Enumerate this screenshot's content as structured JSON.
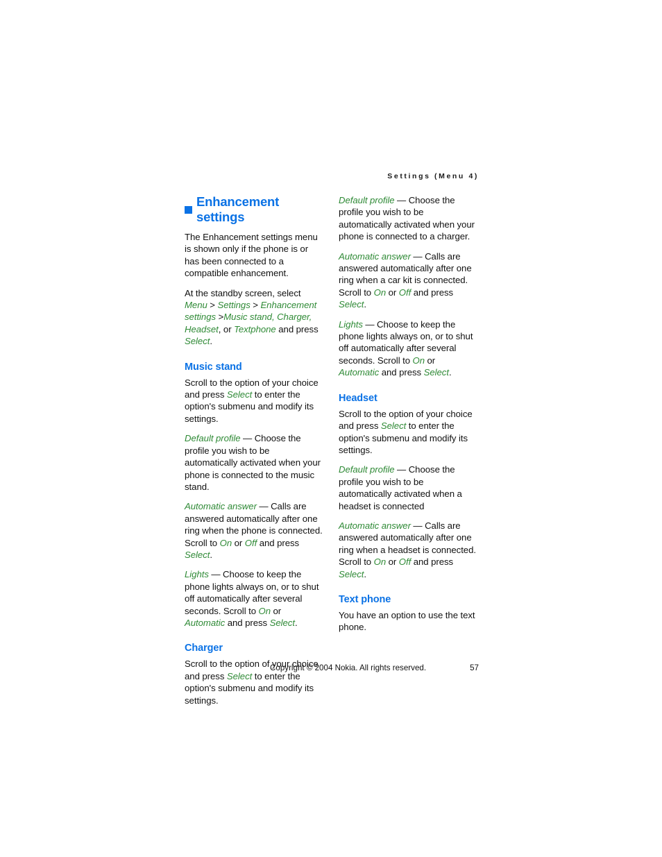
{
  "header": {
    "running_head": "Settings (Menu 4)"
  },
  "chapter": {
    "title": "Enhancement settings"
  },
  "left_column": {
    "intro_paragraph": "The Enhancement settings menu is shown only if the phone is or has been connected to a compatible enhancement.",
    "path_paragraph": {
      "part1": "At the standby screen, select ",
      "menu": "Menu",
      "part2": " > ",
      "settings": "Settings",
      "part3": " > ",
      "enhancement_settings": "Enhancement settings",
      "part4": " >",
      "music_stand": "Music stand, Charger, Headset",
      "part5": ", or ",
      "textphone": "Textphone",
      "part6": " and press ",
      "select": "Select",
      "part7": "."
    },
    "music_stand": {
      "heading": "Music stand",
      "scroll_text": {
        "part1": "Scroll to the option of your choice and press ",
        "select": "Select",
        "part2": " to enter the option's submenu and modify its settings."
      },
      "default_profile": {
        "term": "Default profile",
        "text": " — Choose the profile you wish to be automatically activated when your phone is connected to the music stand."
      },
      "automatic_answer": {
        "term": "Automatic answer",
        "part1": " — Calls are answered automatically after one ring when the phone is connected. Scroll to ",
        "on": "On",
        "part2": " or ",
        "off": "Off",
        "part3": " and press ",
        "select": "Select",
        "part4": "."
      },
      "lights": {
        "term": "Lights",
        "part1": " — Choose to keep the phone lights always on, or to shut off automatically after several seconds. Scroll to ",
        "on": "On",
        "part2": " or ",
        "automatic": "Automatic",
        "part3": " and press ",
        "select": "Select",
        "part4": "."
      }
    },
    "charger": {
      "heading": "Charger",
      "scroll_text": {
        "part1": "Scroll to the option of your choice and press ",
        "select": "Select",
        "part2": " to enter the option's submenu and modify its settings."
      }
    }
  },
  "right_column": {
    "charger_continued": {
      "default_profile": {
        "term": "Default profile",
        "text": " — Choose the profile you wish to be automatically activated when your phone is connected to a charger."
      },
      "automatic_answer": {
        "term": "Automatic answer",
        "part1": " — Calls are answered automatically after one ring when a car kit is connected. Scroll to ",
        "on": "On",
        "part2": " or ",
        "off": "Off",
        "part3": " and press ",
        "select": "Select",
        "part4": "."
      },
      "lights": {
        "term": "Lights",
        "part1": " — Choose to keep the phone lights always on, or to shut off automatically after several seconds. Scroll to ",
        "on": "On",
        "part2": " or ",
        "automatic": "Automatic",
        "part3": " and press ",
        "select": "Select",
        "part4": "."
      }
    },
    "headset": {
      "heading": "Headset",
      "scroll_text": {
        "part1": "Scroll to the option of your choice and press ",
        "select": "Select",
        "part2": " to enter the option's submenu and modify its settings."
      },
      "default_profile": {
        "term": "Default profile",
        "text": " — Choose the profile you wish to be automatically activated when a headset is connected"
      },
      "automatic_answer": {
        "term": "Automatic answer",
        "part1": " — Calls are answered automatically after one ring when a headset is connected. Scroll to ",
        "on": "On",
        "part2": " or ",
        "off": "Off",
        "part3": " and press ",
        "select": "Select",
        "part4": "."
      }
    },
    "text_phone": {
      "heading": "Text phone",
      "text": "You have an option to use the text phone."
    }
  },
  "footer": {
    "copyright": "Copyright © 2004 Nokia. All rights reserved.",
    "page_number": "57"
  },
  "colors": {
    "heading_blue": "#0b72e5",
    "ui_term_green": "#2f8a36",
    "body_text": "#111111"
  }
}
